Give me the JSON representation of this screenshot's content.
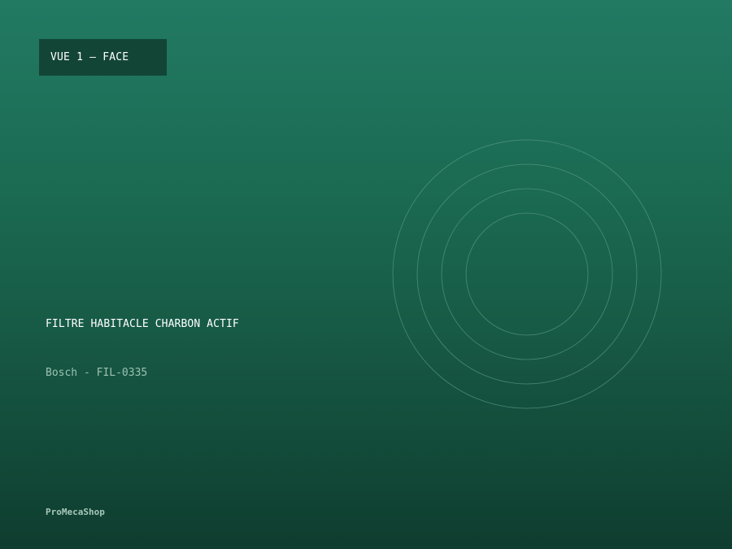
{
  "view": {
    "label": "VUE 1 — FACE"
  },
  "product": {
    "title": "FILTRE HABITACLE CHARBON ACTIF",
    "reference": "Bosch - FIL-0335"
  },
  "brand": {
    "name": "ProMecaShop"
  },
  "illustration": {
    "icon": "concentric-rings-icon",
    "ring_color": "#5a9c86"
  },
  "colors": {
    "background_top": "#227a63",
    "background_bottom": "#0f3d2f",
    "badge": "#134536"
  }
}
